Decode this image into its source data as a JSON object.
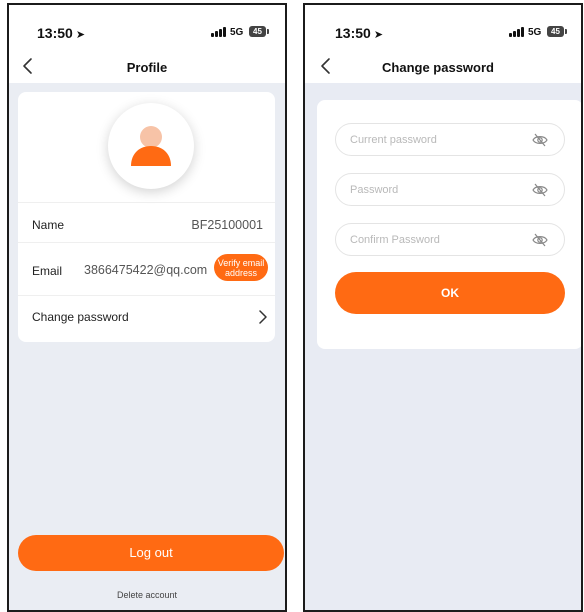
{
  "status_bar": {
    "time": "13:50",
    "network": "5G",
    "battery": "45"
  },
  "profile": {
    "title": "Profile",
    "name_label": "Name",
    "name_value": "BF25100001",
    "email_label": "Email",
    "email_value": "3866475422@qq.com",
    "verify_button": "Verify email address",
    "change_password_label": "Change password",
    "logout_button": "Log out",
    "delete_account": "Delete account"
  },
  "change_password": {
    "title": "Change password",
    "current_password_placeholder": "Current password",
    "password_placeholder": "Password",
    "confirm_password_placeholder": "Confirm Password",
    "ok_button": "OK"
  },
  "icons": {
    "back": "chevron-left-icon",
    "location": "location-arrow-icon",
    "avatar": "user-avatar-icon",
    "row_chevron": "chevron-right-icon",
    "visibility": "eye-off-icon"
  },
  "colors": {
    "accent": "#ff6a13",
    "background": "#eaedf3",
    "card": "#ffffff"
  }
}
